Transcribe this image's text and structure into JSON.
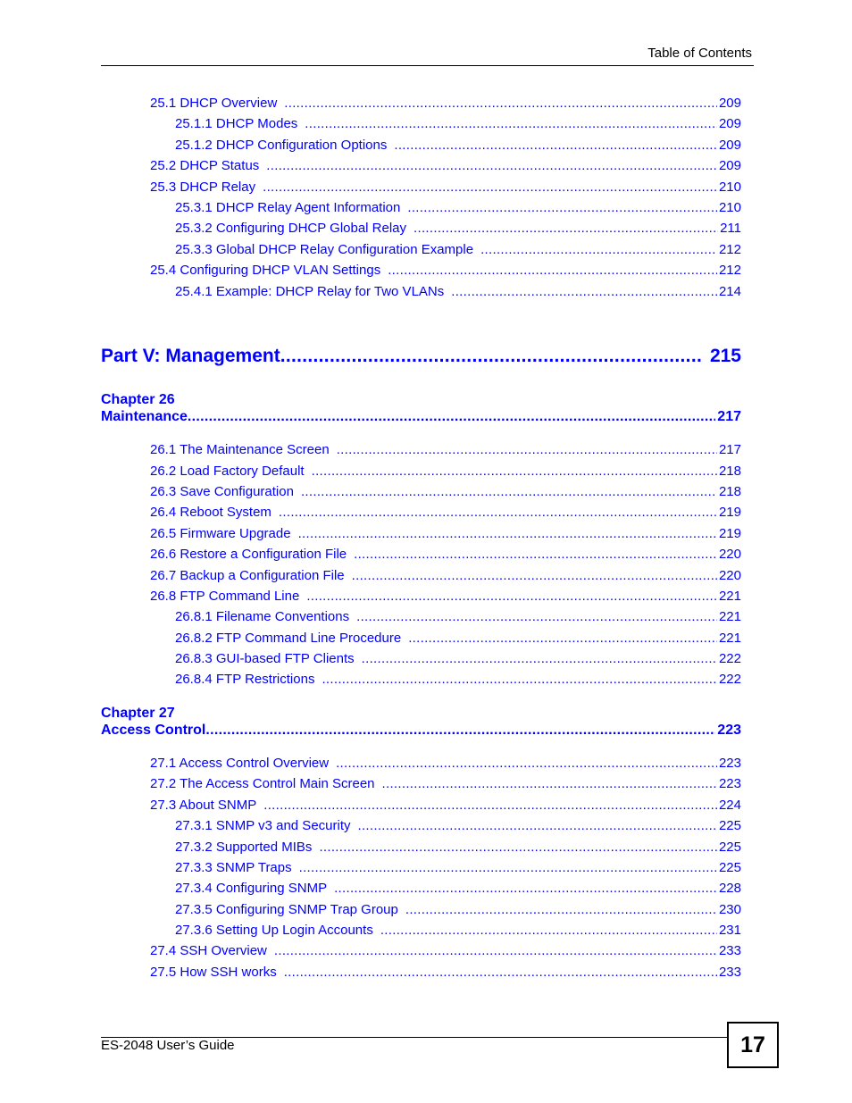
{
  "header": {
    "title": "Table of Contents"
  },
  "sections": [
    {
      "id": "s1",
      "level": 1,
      "title": "25.1 DHCP Overview",
      "page": "209"
    },
    {
      "id": "s2",
      "level": 2,
      "title": "25.1.1 DHCP Modes",
      "page": "209"
    },
    {
      "id": "s3",
      "level": 2,
      "title": "25.1.2 DHCP Configuration Options",
      "page": "209"
    },
    {
      "id": "s4",
      "level": 1,
      "title": "25.2 DHCP Status",
      "page": "209"
    },
    {
      "id": "s5",
      "level": 1,
      "title": "25.3 DHCP Relay",
      "page": "210"
    },
    {
      "id": "s6",
      "level": 2,
      "title": "25.3.1 DHCP Relay Agent Information",
      "page": "210"
    },
    {
      "id": "s7",
      "level": 2,
      "title": "25.3.2 Configuring DHCP Global Relay",
      "page": "211"
    },
    {
      "id": "s8",
      "level": 2,
      "title": "25.3.3 Global DHCP Relay Configuration Example",
      "page": "212"
    },
    {
      "id": "s9",
      "level": 1,
      "title": "25.4 Configuring DHCP VLAN Settings",
      "page": "212"
    },
    {
      "id": "s10",
      "level": 2,
      "title": "25.4.1 Example: DHCP Relay for Two VLANs",
      "page": "214"
    }
  ],
  "part": {
    "title": "Part V: Management",
    "page": "215"
  },
  "chapters": [
    {
      "label": "Chapter  26",
      "title": "Maintenance",
      "page": "217",
      "sections": [
        {
          "level": 1,
          "title": "26.1 The Maintenance Screen",
          "page": "217"
        },
        {
          "level": 1,
          "title": "26.2 Load Factory Default",
          "page": "218"
        },
        {
          "level": 1,
          "title": "26.3 Save Configuration",
          "page": "218"
        },
        {
          "level": 1,
          "title": "26.4 Reboot System",
          "page": "219"
        },
        {
          "level": 1,
          "title": "26.5 Firmware Upgrade",
          "page": "219"
        },
        {
          "level": 1,
          "title": "26.6 Restore a Configuration File",
          "page": "220"
        },
        {
          "level": 1,
          "title": "26.7 Backup a Configuration File",
          "page": "220"
        },
        {
          "level": 1,
          "title": "26.8 FTP Command Line",
          "page": "221"
        },
        {
          "level": 2,
          "title": "26.8.1 Filename Conventions",
          "page": "221"
        },
        {
          "level": 2,
          "title": "26.8.2 FTP Command Line Procedure",
          "page": "221"
        },
        {
          "level": 2,
          "title": "26.8.3 GUI-based FTP Clients",
          "page": "222"
        },
        {
          "level": 2,
          "title": "26.8.4 FTP Restrictions",
          "page": "222"
        }
      ]
    },
    {
      "label": "Chapter  27",
      "title": "Access Control",
      "page": "223",
      "sections": [
        {
          "level": 1,
          "title": "27.1 Access Control Overview",
          "page": "223"
        },
        {
          "level": 1,
          "title": "27.2 The Access Control Main Screen",
          "page": "223"
        },
        {
          "level": 1,
          "title": "27.3 About SNMP",
          "page": "224"
        },
        {
          "level": 2,
          "title": "27.3.1 SNMP v3 and Security",
          "page": "225"
        },
        {
          "level": 2,
          "title": "27.3.2 Supported MIBs",
          "page": "225"
        },
        {
          "level": 2,
          "title": "27.3.3 SNMP Traps",
          "page": "225"
        },
        {
          "level": 2,
          "title": "27.3.4 Configuring SNMP",
          "page": "228"
        },
        {
          "level": 2,
          "title": "27.3.5 Configuring SNMP Trap Group",
          "page": "230"
        },
        {
          "level": 2,
          "title": "27.3.6 Setting Up Login Accounts",
          "page": "231"
        },
        {
          "level": 1,
          "title": "27.4 SSH Overview",
          "page": "233"
        },
        {
          "level": 1,
          "title": "27.5 How SSH works",
          "page": "233"
        }
      ]
    }
  ],
  "footer": {
    "title": "ES-2048 User’s Guide",
    "page_number": "17"
  },
  "colors": {
    "link": "#0000ff",
    "text": "#000000"
  }
}
